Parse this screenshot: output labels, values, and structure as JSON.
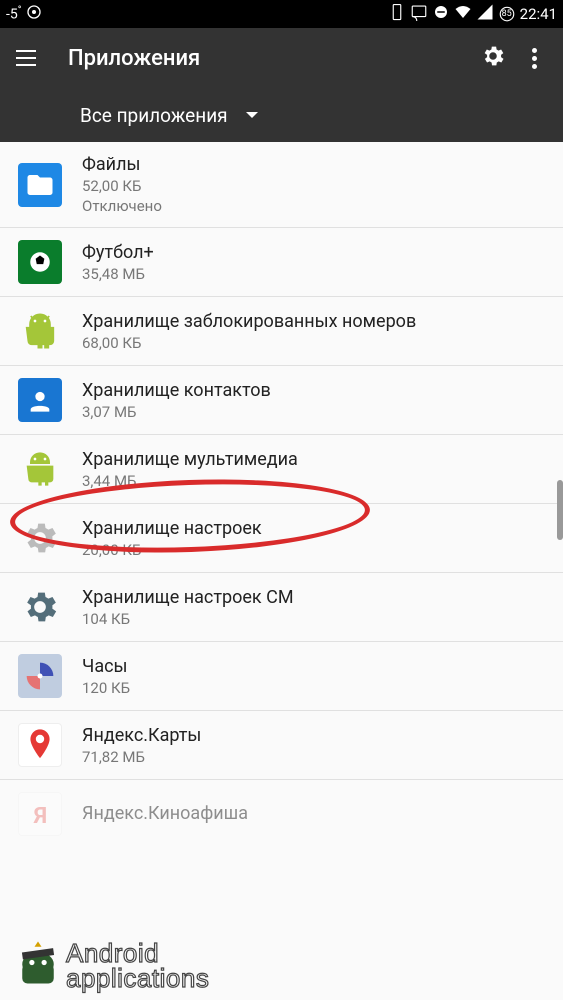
{
  "status": {
    "temp": "-5",
    "time": "22:41",
    "battery": "85"
  },
  "header": {
    "title": "Приложения",
    "filter": "Все приложения"
  },
  "apps": [
    {
      "name": "Файлы",
      "size": "52,00 КБ",
      "status": "Отключено",
      "icon": "files"
    },
    {
      "name": "Футбол+",
      "size": "35,48 МБ",
      "icon": "football"
    },
    {
      "name": "Хранилище заблокированных номеров",
      "size": "68,00 КБ",
      "icon": "android"
    },
    {
      "name": "Хранилище контактов",
      "size": "3,07 МБ",
      "icon": "contacts"
    },
    {
      "name": "Хранилище мультимедиа",
      "size": "3,44 МБ",
      "icon": "android",
      "highlighted": true
    },
    {
      "name": "Хранилище настроек",
      "size": "20,00 КБ",
      "icon": "gear"
    },
    {
      "name": "Хранилище настроек CM",
      "size": "104 КБ",
      "icon": "gear-dark"
    },
    {
      "name": "Часы",
      "size": "120 КБ",
      "icon": "clock"
    },
    {
      "name": "Яндекс.Карты",
      "size": "71,82 МБ",
      "icon": "yandex"
    },
    {
      "name": "Яндекс.Киноафиша",
      "size": "",
      "icon": "yandex"
    }
  ],
  "watermark": {
    "line1": "Android",
    "line2": "applications"
  }
}
